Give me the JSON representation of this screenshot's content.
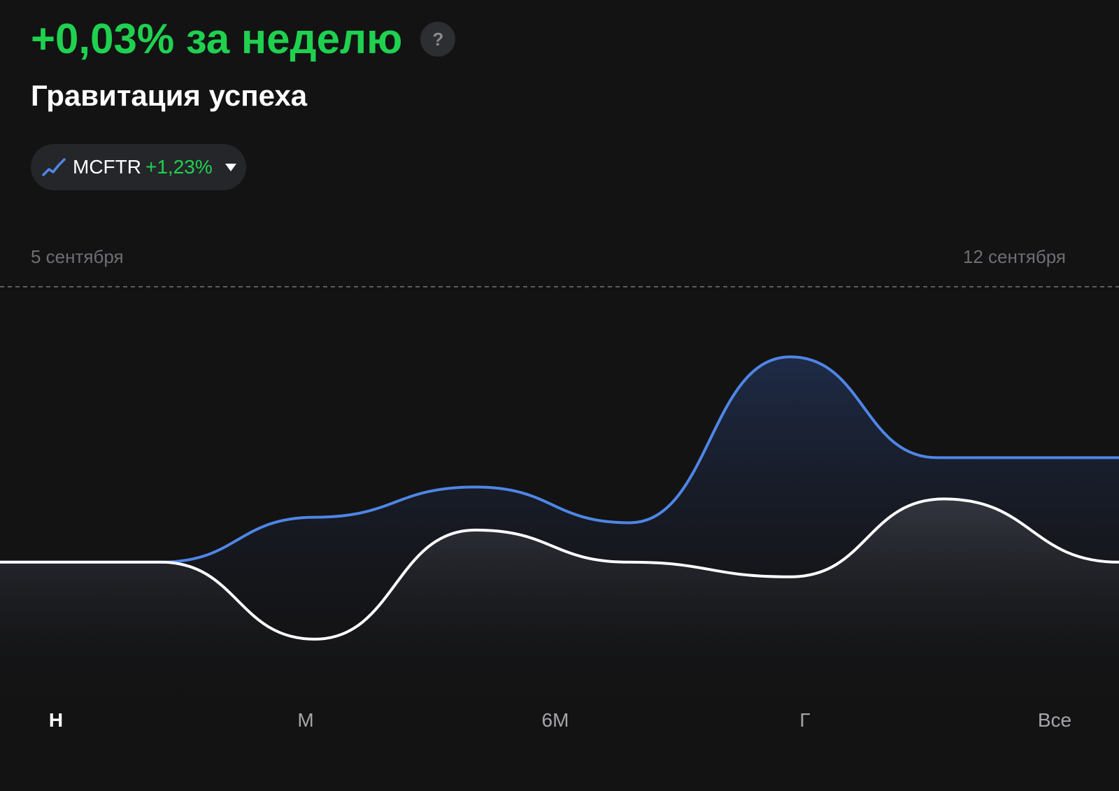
{
  "header": {
    "performance_text": "+0,03% за неделю",
    "help_label": "?",
    "portfolio_name": "Гравитация успеха"
  },
  "benchmark": {
    "icon": "trend-line-icon",
    "name": "MCFTR",
    "change": "+1,23%"
  },
  "date_range": {
    "start": "5 сентября",
    "end": "12 сентября"
  },
  "period_tabs": [
    {
      "label": "Н",
      "active": true
    },
    {
      "label": "М",
      "active": false
    },
    {
      "label": "6М",
      "active": false
    },
    {
      "label": "Г",
      "active": false
    },
    {
      "label": "Все",
      "active": false
    }
  ],
  "colors": {
    "background": "#131314",
    "positive": "#1fd14f",
    "benchmark_line": "#4f86e6",
    "portfolio_line": "#ffffff",
    "chip_background": "#25262a"
  },
  "chart_data": {
    "type": "line",
    "title": "",
    "xlabel": "",
    "ylabel": "",
    "x": [
      0,
      1,
      2,
      3,
      4,
      5,
      6
    ],
    "series": [
      {
        "name": "MCFTR",
        "color": "#4f86e6",
        "values": [
          0,
          0.49,
          0.82,
          0.43,
          2.24,
          1.14,
          1.14
        ]
      },
      {
        "name": "",
        "color": "#ffffff",
        "values": [
          0,
          -0.84,
          0.35,
          0,
          -0.16,
          0.69,
          0
        ]
      }
    ],
    "ylim": [
      -1.1,
      2.6
    ],
    "grid": false
  }
}
